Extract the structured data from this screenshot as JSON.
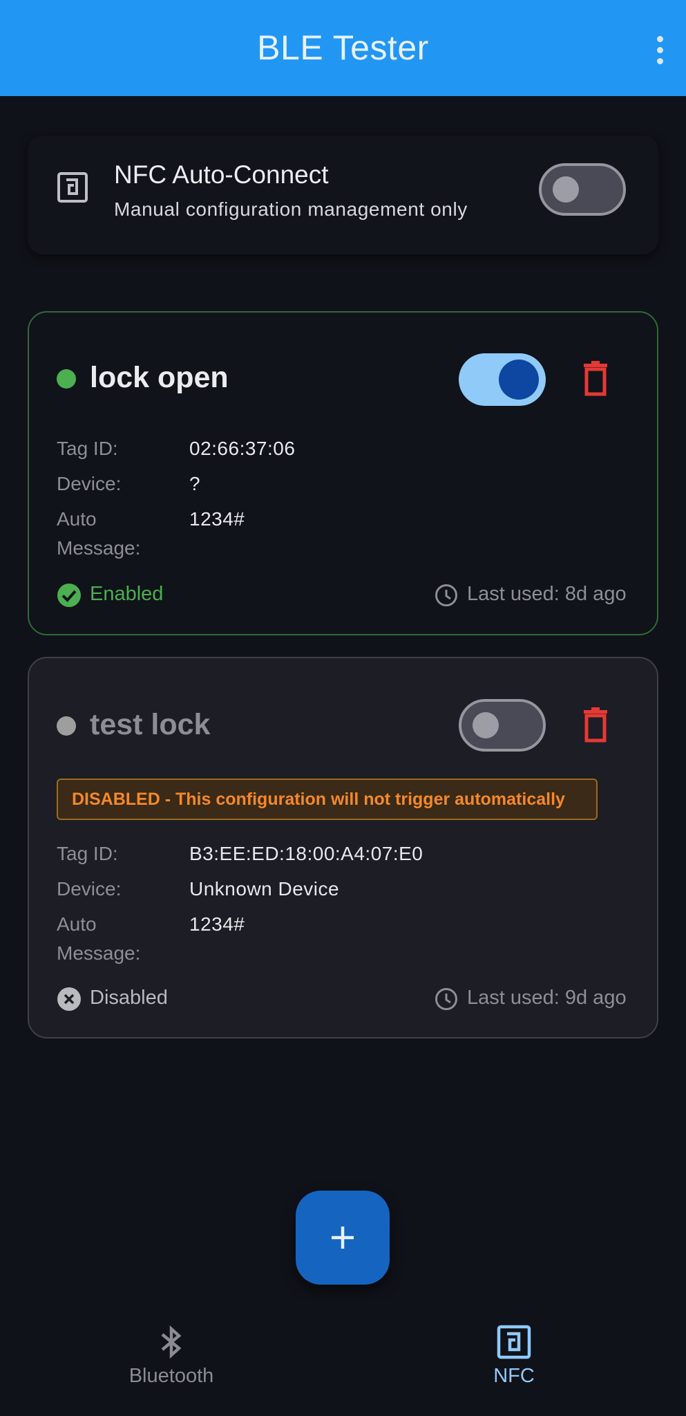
{
  "app_bar": {
    "title": "BLE Tester",
    "menu_icon": "more-vert-icon"
  },
  "auto_connect": {
    "icon": "nfc-icon",
    "title": "NFC Auto-Connect",
    "subtitle": "Manual configuration management only",
    "switch_on": false
  },
  "configs": [
    {
      "name": "lock open",
      "switch_on": true,
      "status_dot_color": "#4caf50",
      "labels": {
        "tag_id": "Tag ID:",
        "device": "Device:",
        "auto_message": "Auto Message:"
      },
      "tag_id": "02:66:37:06",
      "device": "?",
      "auto_message": "1234#",
      "status_icon": "check-circle-icon",
      "status_text": "Enabled",
      "status_color": "#4caf50",
      "last_used": "Last used: 8d ago"
    },
    {
      "name": "test lock",
      "switch_on": false,
      "status_dot_color": "#9e9e9e",
      "warning": "DISABLED - This configuration will not trigger automatically",
      "labels": {
        "tag_id": "Tag ID:",
        "device": "Device:",
        "auto_message": "Auto Message:"
      },
      "tag_id": "B3:EE:ED:18:00:A4:07:E0",
      "device": "Unknown Device",
      "auto_message": "1234#",
      "status_icon": "cancel-circle-icon",
      "status_text": "Disabled",
      "status_color": "#b9bac0",
      "last_used": "Last used: 9d ago"
    }
  ],
  "fab": {
    "icon": "add-icon"
  },
  "bottom_nav": {
    "items": [
      {
        "label": "Bluetooth",
        "icon": "bluetooth-icon",
        "active": false
      },
      {
        "label": "NFC",
        "icon": "nfc-icon",
        "active": true
      }
    ]
  },
  "colors": {
    "app_bar": "#2196f3",
    "background": "#101219",
    "accent": "#90caf9",
    "delete": "#e53935",
    "warning": "#f5882a"
  }
}
